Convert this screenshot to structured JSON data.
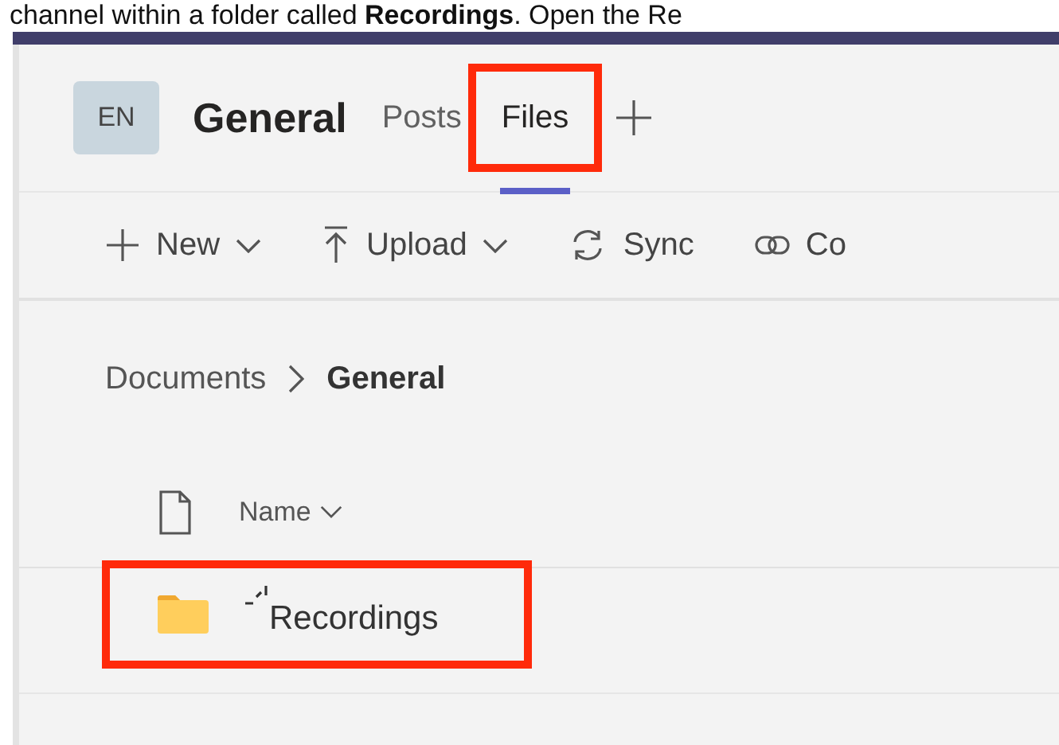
{
  "caption": "channel within a folder called **Recordings**. Open the Re",
  "team": {
    "avatar": "EN",
    "channel": "General"
  },
  "tabs": [
    {
      "label": "Posts",
      "selected": false,
      "highlighted": false
    },
    {
      "label": "Files",
      "selected": true,
      "highlighted": true
    }
  ],
  "toolbar": [
    {
      "label": "New",
      "dropdown": true
    },
    {
      "label": "Upload",
      "dropdown": true
    },
    {
      "label": "Sync",
      "dropdown": false
    },
    {
      "label": "Co",
      "dropdown": false
    }
  ],
  "breadcrumb": [
    {
      "label": "Documents",
      "current": false
    },
    {
      "label": "General",
      "current": true
    }
  ],
  "columns": [
    {
      "label": "Name",
      "sortable": true
    }
  ],
  "rows": [
    {
      "name": "Recordings",
      "kind": "folder",
      "new": true,
      "highlighted": true
    }
  ]
}
